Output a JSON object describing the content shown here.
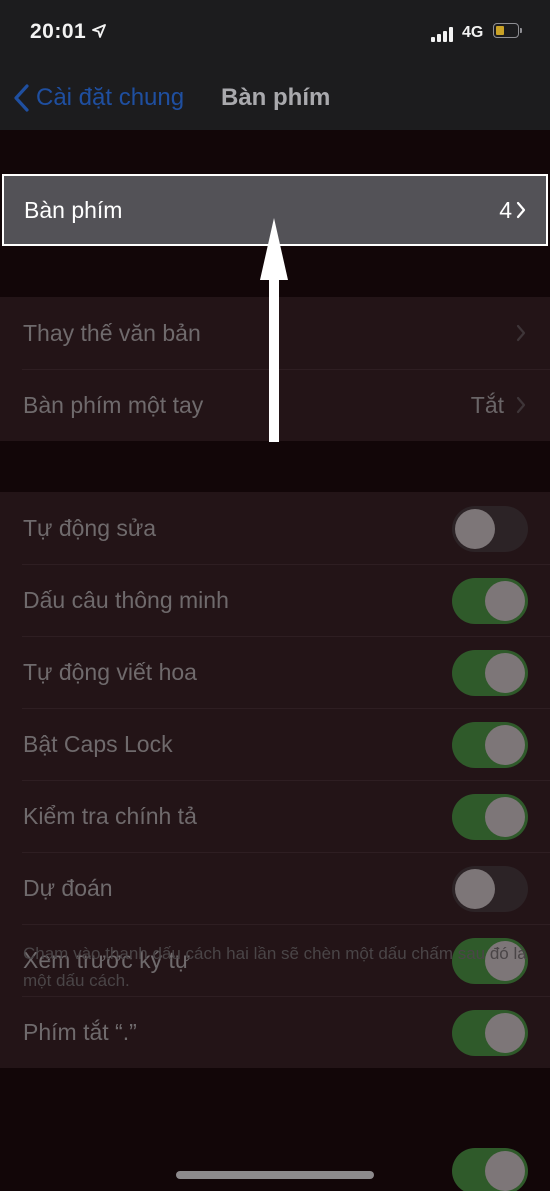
{
  "status_bar": {
    "time": "20:01",
    "network": "4G",
    "battery_color": "#c9a227"
  },
  "nav": {
    "back_label": "Cài đặt chung",
    "title": "Bàn phím"
  },
  "keyboards_row": {
    "label": "Bàn phím",
    "value": "4"
  },
  "group_text": [
    {
      "label": "Thay thế văn bản",
      "value": ""
    },
    {
      "label": "Bàn phím một tay",
      "value": "Tắt"
    }
  ],
  "toggles": [
    {
      "label": "Tự động sửa",
      "on": false
    },
    {
      "label": "Dấu câu thông minh",
      "on": true
    },
    {
      "label": "Tự động viết hoa",
      "on": true
    },
    {
      "label": "Bật Caps Lock",
      "on": true
    },
    {
      "label": "Kiểm tra chính tả",
      "on": true
    },
    {
      "label": "Dự đoán",
      "on": false
    },
    {
      "label": "Xem trước ký tự",
      "on": true
    },
    {
      "label": "Phím tắt “.”",
      "on": true
    }
  ],
  "footnote": "Chạm vào thanh dấu cách hai lần sẽ chèn một dấu chấm sau đó là một dấu cách.",
  "colors": {
    "accent_link": "#1f4fa0",
    "toggle_on": "#2f5a2a",
    "highlight_border": "#ffffff"
  }
}
